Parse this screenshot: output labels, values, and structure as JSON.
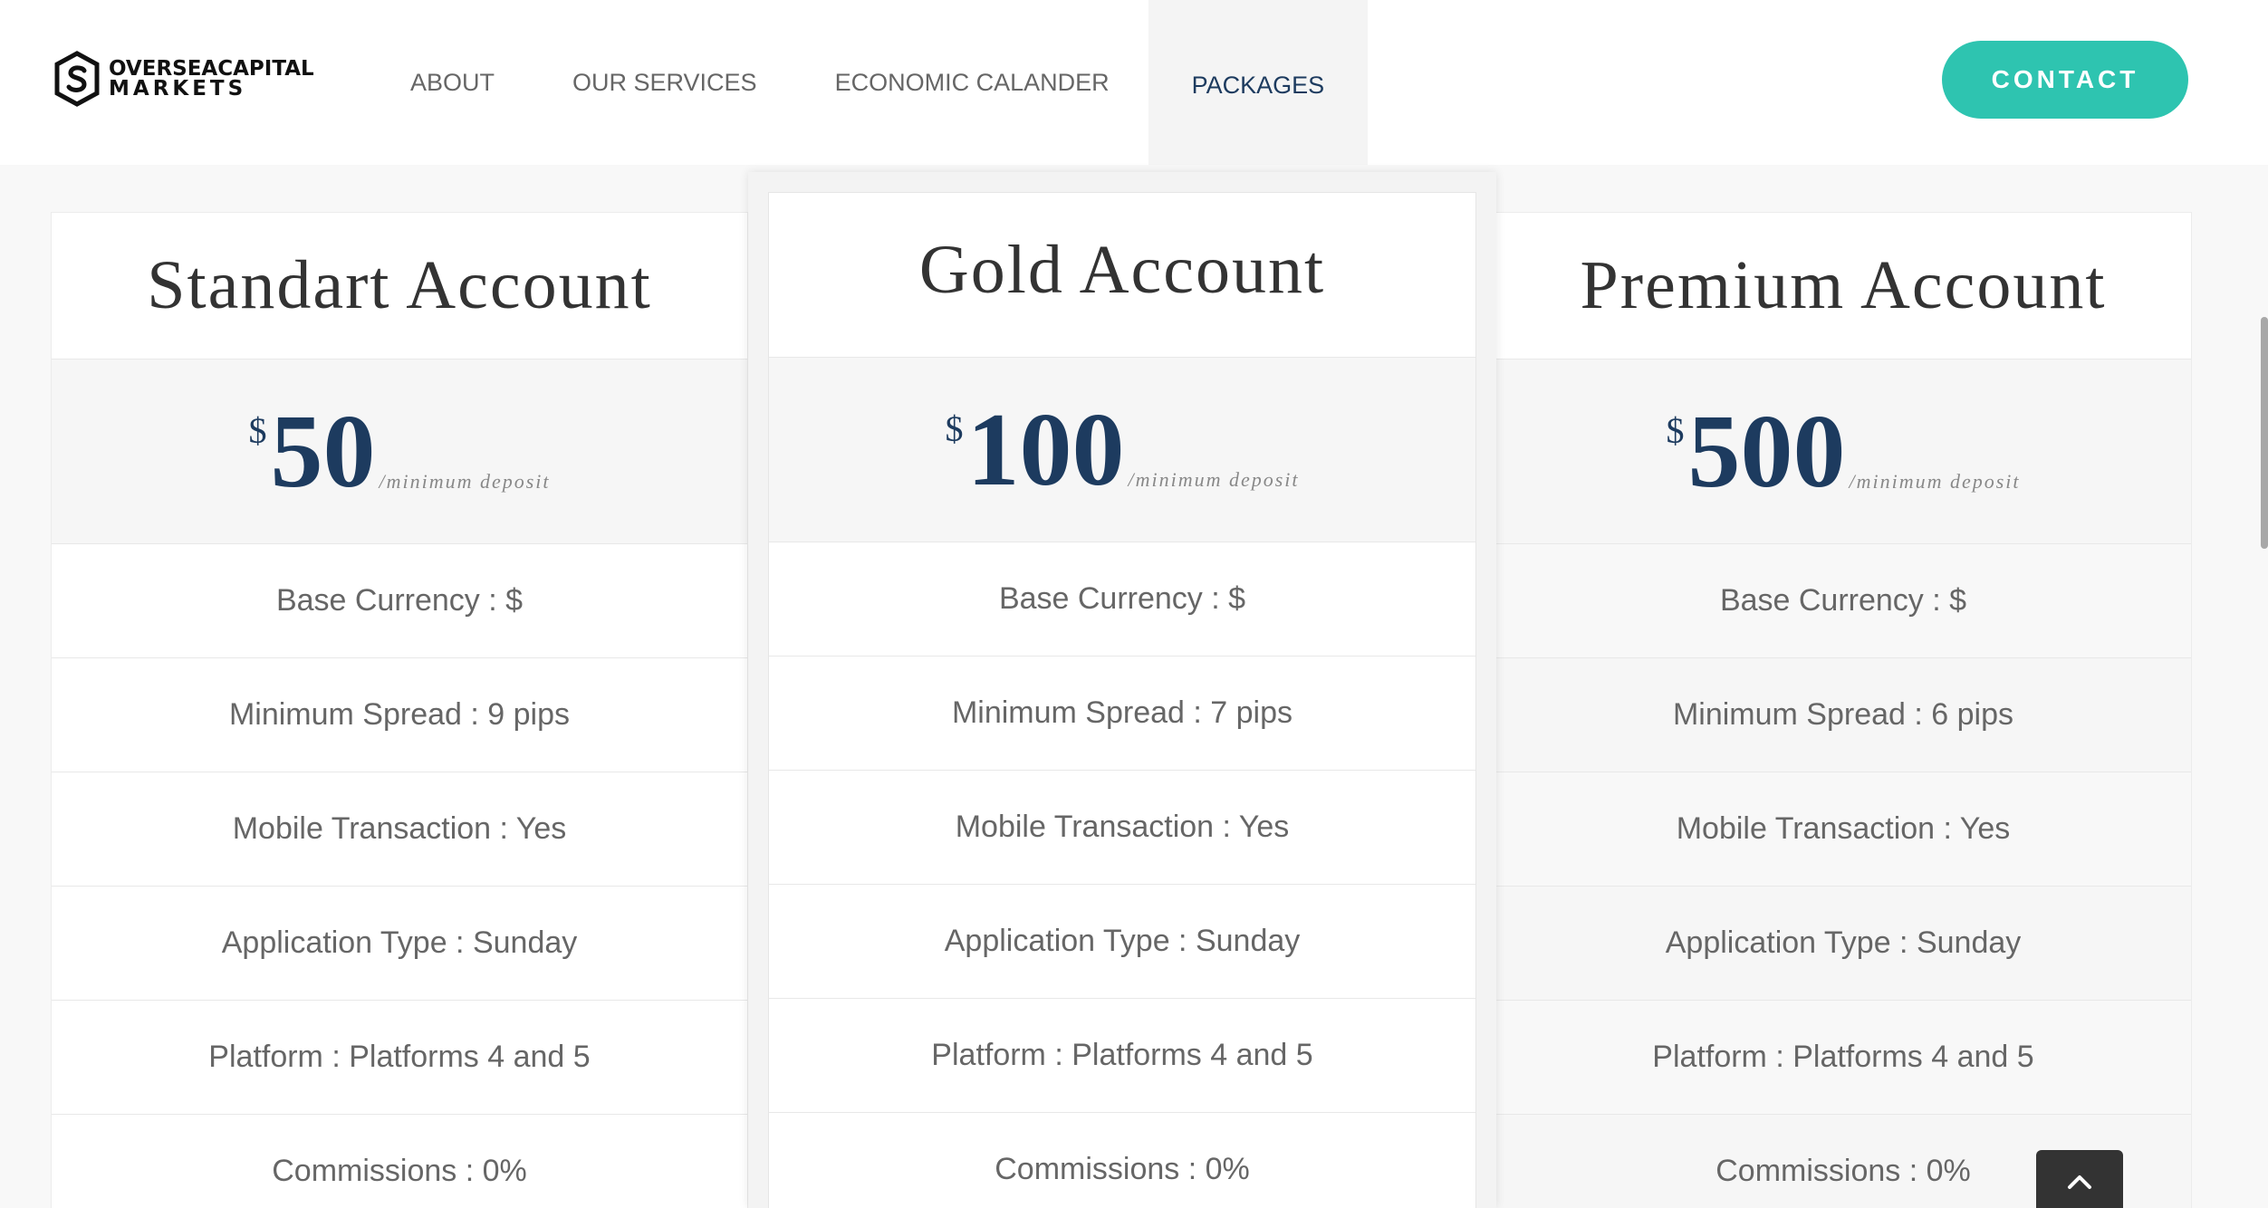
{
  "brand": {
    "line1": "OVERSEACAPITAL",
    "line2": "MARKETS"
  },
  "nav": {
    "items": [
      {
        "label": "ABOUT"
      },
      {
        "label": "OUR SERVICES"
      },
      {
        "label": "ECONOMIC CALANDER"
      },
      {
        "label": "PACKAGES",
        "active": true
      }
    ],
    "contact_label": "CONTACT"
  },
  "colors": {
    "accent": "#2ec4b0",
    "price": "#1d3b5f",
    "text": "#666666"
  },
  "plans": [
    {
      "title": "Standart Account",
      "currency": "$",
      "amount": "50",
      "unit": "/minimum deposit",
      "features": [
        "Base Currency : $",
        "Minimum Spread : 9 pips",
        "Mobile Transaction : Yes",
        "Application Type : Sunday",
        "Platform : Platforms 4 and 5",
        "Commissions : 0%"
      ]
    },
    {
      "title": "Gold Account",
      "currency": "$",
      "amount": "100",
      "unit": "/minimum deposit",
      "features": [
        "Base Currency : $",
        "Minimum Spread : 7 pips",
        "Mobile Transaction : Yes",
        "Application Type : Sunday",
        "Platform : Platforms 4 and 5",
        "Commissions : 0%"
      ]
    },
    {
      "title": "Premium Account",
      "currency": "$",
      "amount": "500",
      "unit": "/minimum deposit",
      "features": [
        "Base Currency : $",
        "Minimum Spread : 6 pips",
        "Mobile Transaction : Yes",
        "Application Type : Sunday",
        "Platform : Platforms 4 and 5",
        "Commissions : 0%"
      ]
    }
  ],
  "icons": {
    "logo": "dollar-s-logo-icon",
    "back_to_top": "chevron-up-icon"
  }
}
